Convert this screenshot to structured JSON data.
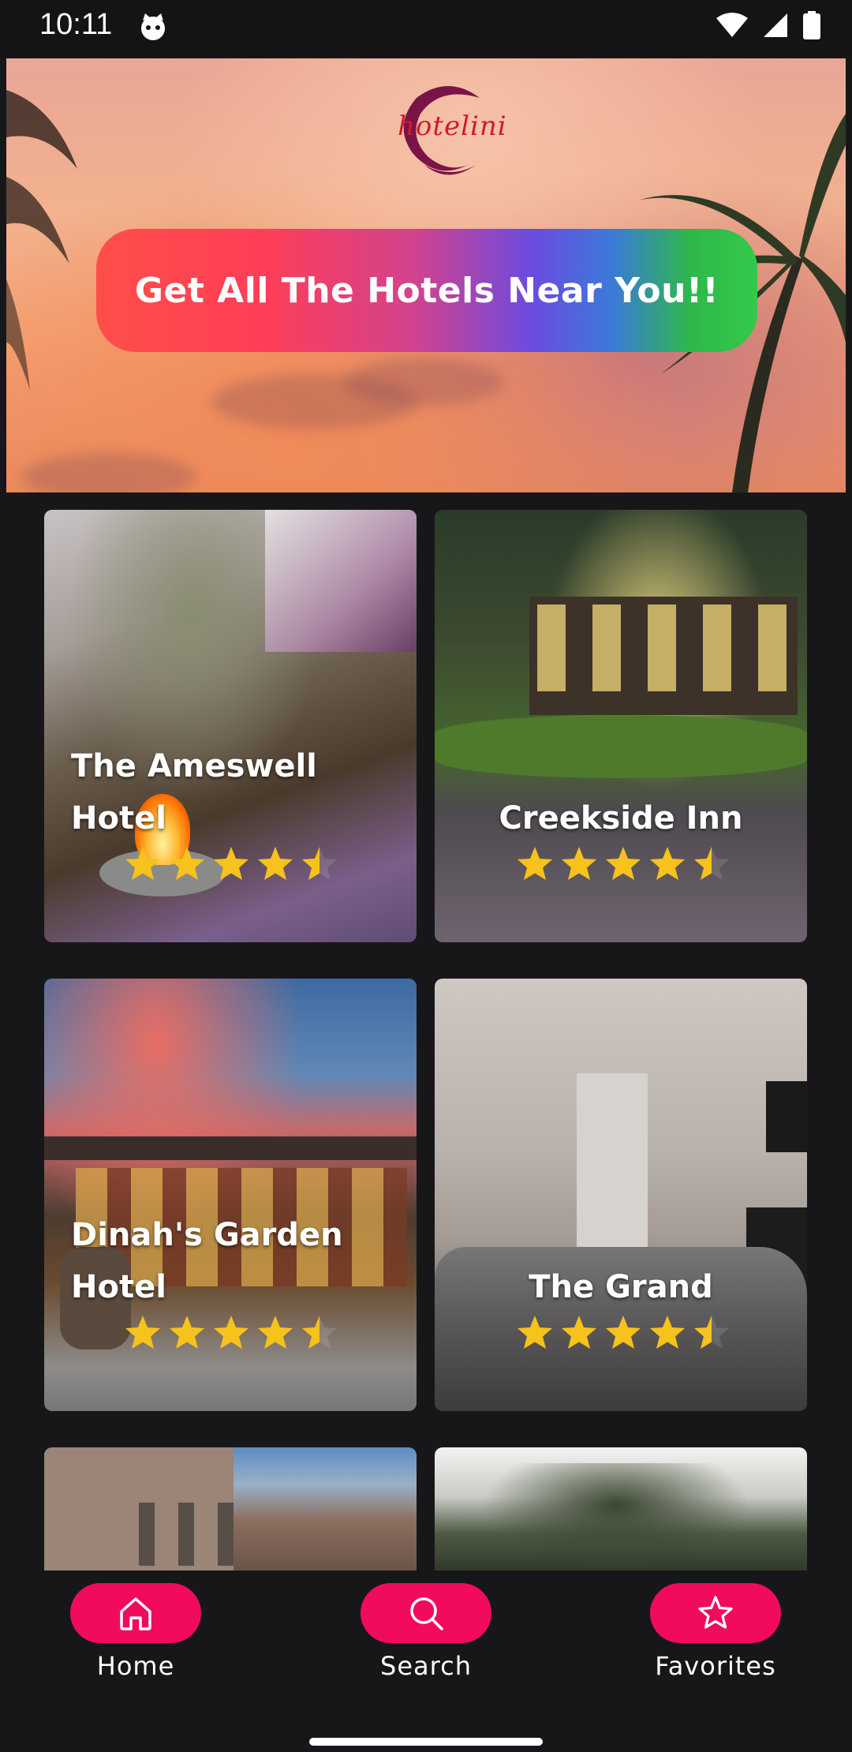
{
  "status_bar": {
    "time": "10:11"
  },
  "hero": {
    "logo_text": "hotelini",
    "cta_label": "Get All The Hotels Near You!!"
  },
  "hotels": [
    {
      "name_line1": "The Ameswell",
      "name_line2": "Hotel",
      "rating": 4.5
    },
    {
      "name_line1": "Creekside Inn",
      "name_line2": "",
      "rating": 4.5
    },
    {
      "name_line1": "Dinah's Garden",
      "name_line2": "Hotel",
      "rating": 4.5
    },
    {
      "name_line1": "The Grand",
      "name_line2": "",
      "rating": 4.5
    }
  ],
  "nav": {
    "home": "Home",
    "search": "Search",
    "favorites": "Favorites"
  },
  "colors": {
    "nav_accent": "#f20a5e",
    "star": "#f6c21b",
    "background": "#171719"
  }
}
